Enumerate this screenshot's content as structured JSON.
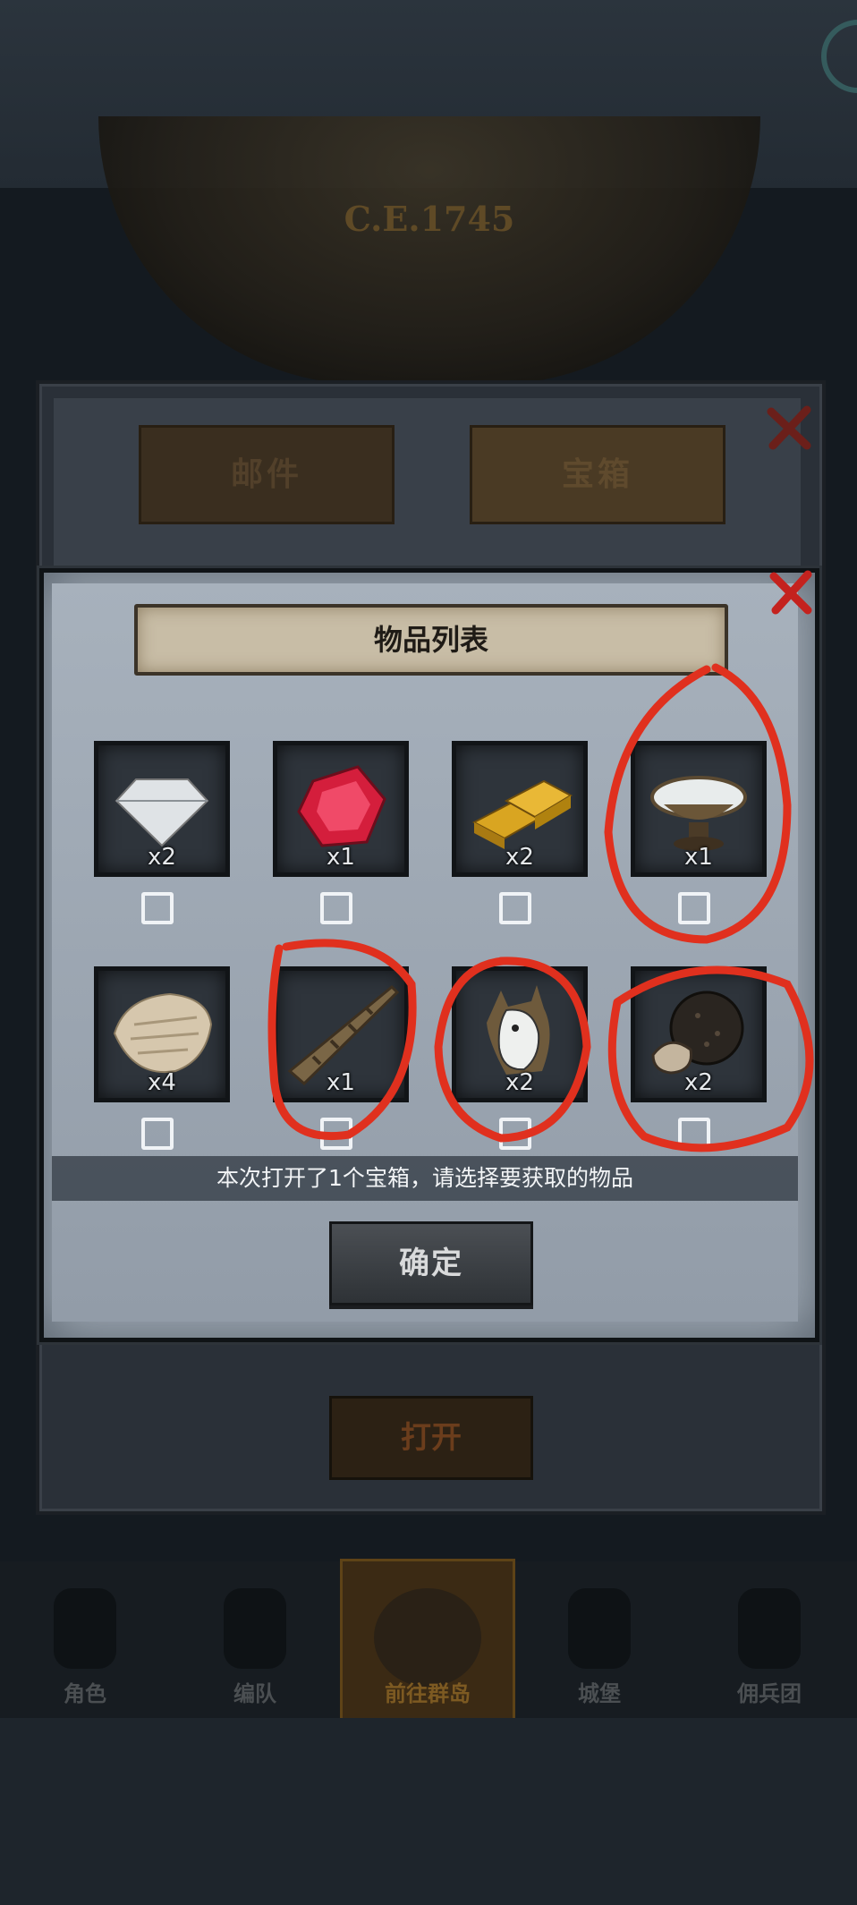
{
  "background": {
    "year_label": "C.E.1745",
    "mail_tabs": [
      "邮件",
      "宝箱"
    ],
    "open_button": "打开",
    "nav": [
      {
        "label": "角色",
        "icon": "character-icon"
      },
      {
        "label": "编队",
        "icon": "formation-icon"
      },
      {
        "label": "前往群岛",
        "icon": "islands-compass-icon",
        "active": true
      },
      {
        "label": "城堡",
        "icon": "castle-icon"
      },
      {
        "label": "佣兵团",
        "icon": "mercenary-icon"
      }
    ]
  },
  "dialog": {
    "title": "物品列表",
    "items": [
      {
        "name": "diamond",
        "qty": "x2",
        "checked": false
      },
      {
        "name": "ruby",
        "qty": "x1",
        "checked": false
      },
      {
        "name": "gold-bars",
        "qty": "x2",
        "checked": false
      },
      {
        "name": "silver-bowl",
        "qty": "x1",
        "checked": false
      },
      {
        "name": "fur-pelt",
        "qty": "x4",
        "checked": false
      },
      {
        "name": "unicorn-horn",
        "qty": "x1",
        "checked": false
      },
      {
        "name": "horse-head",
        "qty": "x2",
        "checked": false
      },
      {
        "name": "truffle",
        "qty": "x2",
        "checked": false
      }
    ],
    "hint": "本次打开了1个宝箱，请选择要获取的物品",
    "confirm_button": "确定"
  },
  "colors": {
    "annotation": "#e0301e",
    "panel": "#9fa9b4",
    "title_scroll": "#c8bda6"
  }
}
